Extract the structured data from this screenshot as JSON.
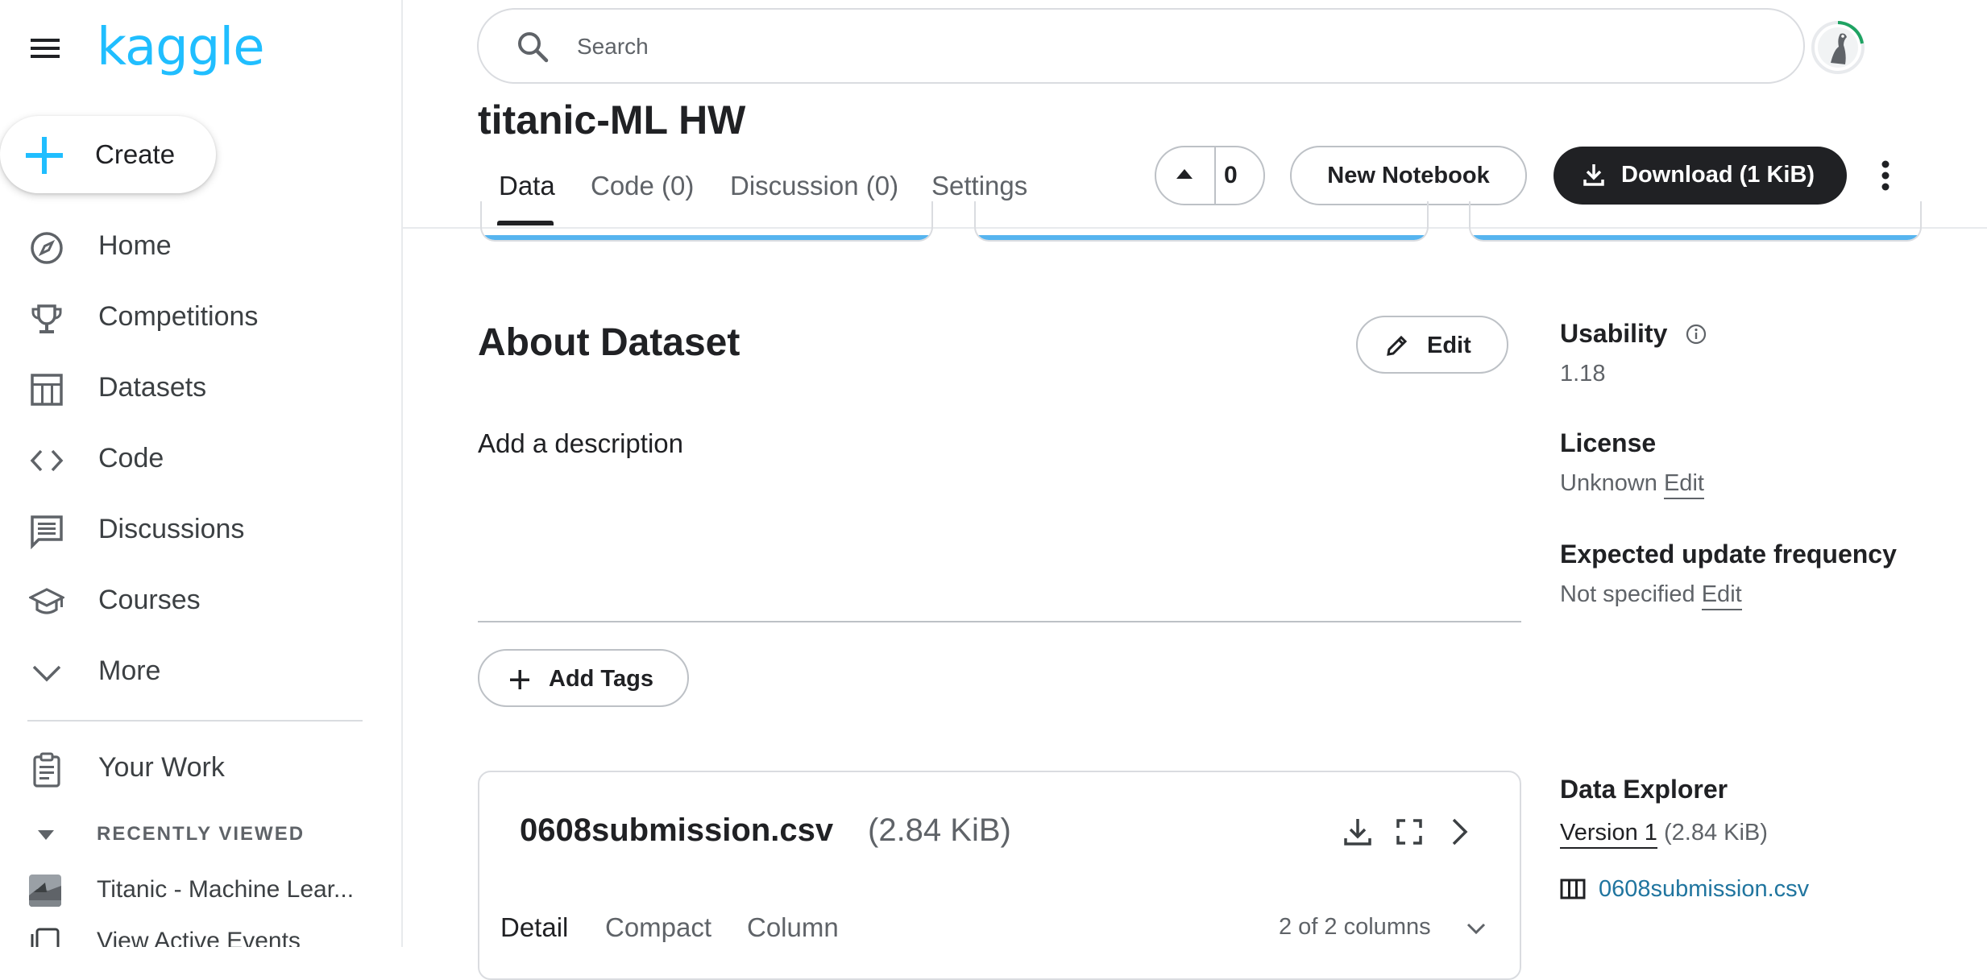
{
  "app": {
    "logo_text": "kaggle",
    "brand_color": "#20beff",
    "accent_color": "#56b4ef"
  },
  "sidebar": {
    "create_label": "Create",
    "items": [
      {
        "label": "Home",
        "icon": "compass-icon"
      },
      {
        "label": "Competitions",
        "icon": "trophy-icon"
      },
      {
        "label": "Datasets",
        "icon": "table-icon"
      },
      {
        "label": "Code",
        "icon": "code-icon"
      },
      {
        "label": "Discussions",
        "icon": "comment-icon"
      },
      {
        "label": "Courses",
        "icon": "school-icon"
      },
      {
        "label": "More",
        "icon": "chevron-down-icon"
      },
      {
        "label": "Your Work",
        "icon": "clipboard-icon"
      }
    ],
    "recent_heading": "RECENTLY VIEWED",
    "recent_items": [
      {
        "label": "Titanic - Machine Lear...",
        "icon": "titanic-thumbnail"
      },
      {
        "label": "View Active Events",
        "icon": "events-icon"
      }
    ]
  },
  "header": {
    "search_placeholder": "Search",
    "title": "titanic-ML HW",
    "tabs": [
      {
        "label": "Data",
        "active": true
      },
      {
        "label": "Code (0)",
        "active": false
      },
      {
        "label": "Discussion (0)",
        "active": false
      },
      {
        "label": "Settings",
        "active": false
      }
    ],
    "vote_count": "0",
    "new_notebook_label": "New Notebook",
    "download_label": "Download (1 KiB)"
  },
  "about": {
    "title": "About Dataset",
    "edit_label": "Edit",
    "description_placeholder": "Add a description",
    "add_tags_label": "Add Tags"
  },
  "file_card": {
    "file_name": "0608submission.csv",
    "file_size": "(2.84 KiB)",
    "view_tabs": [
      {
        "label": "Detail",
        "active": true
      },
      {
        "label": "Compact",
        "active": false
      },
      {
        "label": "Column",
        "active": false
      }
    ],
    "columns_label": "2 of 2 columns"
  },
  "right_panel": {
    "usability_heading": "Usability",
    "usability_value": "1.18",
    "license_heading": "License",
    "license_value": "Unknown",
    "license_edit": "Edit",
    "frequency_heading": "Expected update frequency",
    "frequency_value": "Not specified",
    "frequency_edit": "Edit",
    "explorer_heading": "Data Explorer",
    "version_link": "Version 1",
    "version_size": "(2.84 KiB)",
    "explorer_file": "0608submission.csv"
  }
}
